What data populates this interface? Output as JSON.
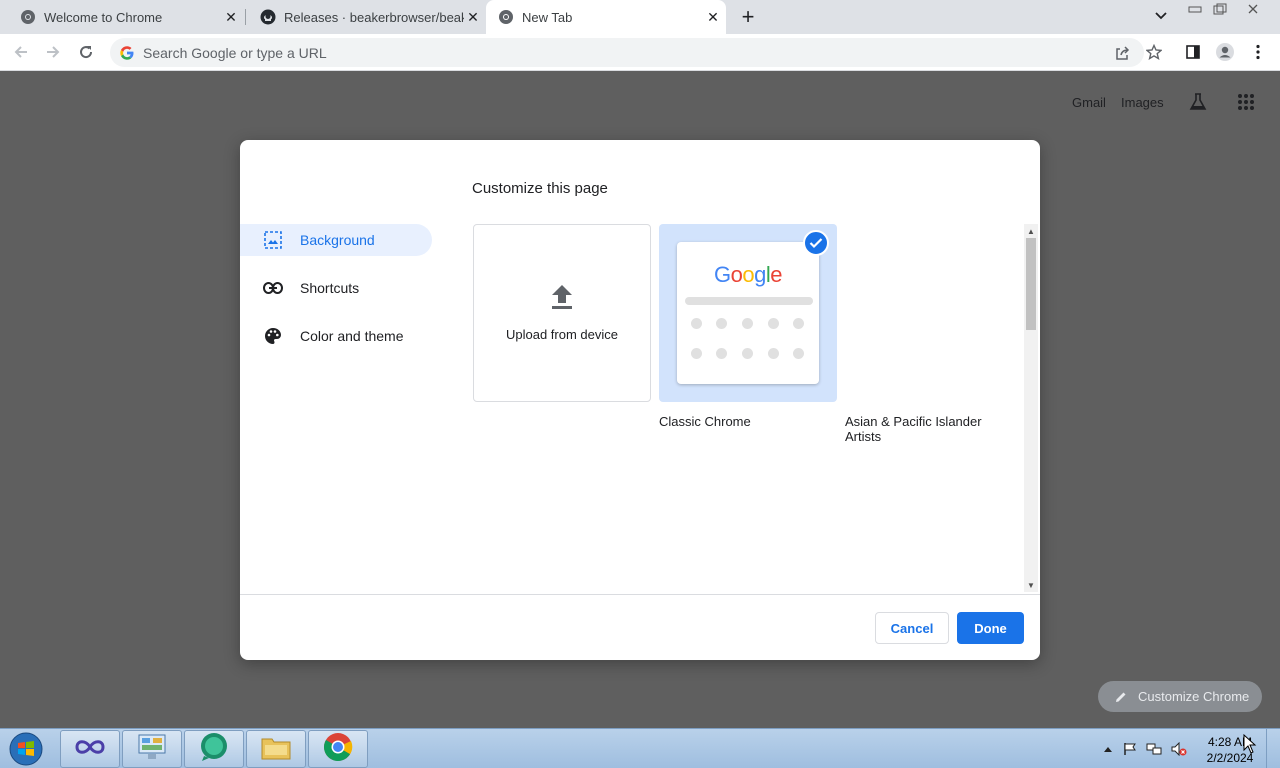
{
  "browser": {
    "tabs": [
      {
        "title": "Welcome to Chrome",
        "favicon": "chrome-icon",
        "active": false
      },
      {
        "title": "Releases · beakerbrowser/beaker",
        "favicon": "github-icon",
        "active": false
      },
      {
        "title": "New Tab",
        "favicon": "chrome-icon",
        "active": true
      }
    ],
    "omnibox": {
      "placeholder": "Search Google or type a URL"
    }
  },
  "ntp": {
    "gmail": "Gmail",
    "images": "Images",
    "customize_chip": "Customize Chrome"
  },
  "dialog": {
    "title": "Customize this page",
    "nav": [
      {
        "label": "Background",
        "icon": "image-icon",
        "selected": true
      },
      {
        "label": "Shortcuts",
        "icon": "link-icon",
        "selected": false
      },
      {
        "label": "Color and theme",
        "icon": "palette-icon",
        "selected": false
      }
    ],
    "tiles": {
      "upload_label": "Upload from device",
      "classic_logo": "Google",
      "classic_label": "Classic Chrome",
      "artists_label": "Asian & Pacific Islander Artists"
    },
    "cancel": "Cancel",
    "done": "Done"
  },
  "taskbar": {
    "clock_time": "4:28 AM",
    "clock_date": "2/2/2024"
  },
  "colors": {
    "accent": "#1a73e8",
    "selected_bg": "#e8f0fe",
    "backdrop": "#5f5f5f"
  }
}
